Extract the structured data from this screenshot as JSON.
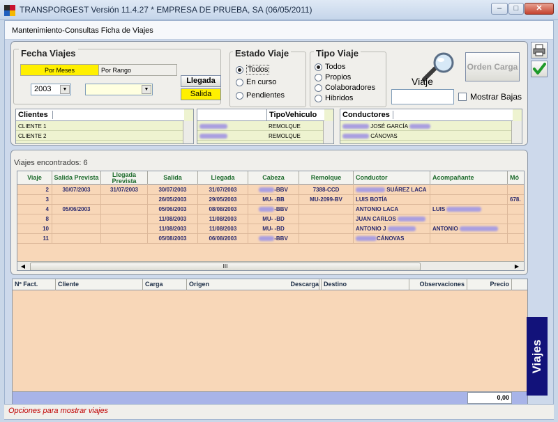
{
  "window": {
    "title": "TRANSPORGEST Versión 11.4.27 * EMPRESA DE PRUEBA, SA (06/05/2011)",
    "subtitle": "Mantenimiento-Consultas Ficha de Viajes"
  },
  "fecha": {
    "title": "Fecha Viajes",
    "tabs": [
      "Por Meses",
      "Por Rango"
    ],
    "year": "2003",
    "month": "",
    "llegada_label": "Llegada",
    "salida_label": "Salida"
  },
  "estado": {
    "title": "Estado Viaje",
    "options": [
      "Todos",
      "En curso",
      "Pendientes"
    ],
    "selected": "Todos"
  },
  "tipo": {
    "title": "Tipo Viaje",
    "options": [
      "Todos",
      "Propios",
      "Colaboradores",
      "Hibridos"
    ],
    "selected": "Todos"
  },
  "viaje": {
    "label": "Viaje",
    "value": ""
  },
  "orden_carga_label": "Orden Carga",
  "mostrar_bajas_label": "Mostrar Bajas",
  "clientes": {
    "header": "Clientes",
    "rows": [
      "CLIENTE 1",
      "CLIENTE 2"
    ]
  },
  "vehiculos": {
    "header": "TipoVehiculo",
    "rows": [
      "REMOLQUE",
      "REMOLQUE"
    ]
  },
  "conductores": {
    "header": "Conductores",
    "rows": [
      "JOSÉ GARCÍA",
      "CÁNOVAS"
    ]
  },
  "viajes": {
    "count_label": "Viajes encontrados: 6",
    "headers": [
      "Viaje",
      "Salida Prevista",
      "Llegada Prevista",
      "Salida",
      "Llegada",
      "Cabeza",
      "Remolque",
      "Conductor",
      "Acompañante",
      "Mó"
    ],
    "rows": [
      [
        "2",
        "30/07/2003",
        "31/07/2003",
        "30/07/2003",
        "31/07/2003",
        "-BBV",
        "7388-CCD",
        "SUÁREZ LACA",
        "",
        ""
      ],
      [
        "3",
        "",
        "",
        "26/05/2003",
        "29/05/2003",
        "MU-   -BB",
        "MU-2099-BV",
        "LUIS   BOTÍA",
        "",
        "678."
      ],
      [
        "4",
        "05/06/2003",
        "",
        "05/06/2003",
        "08/08/2003",
        "-BBV",
        "",
        "ANTONIO   LACA",
        "LUIS",
        ""
      ],
      [
        "8",
        "",
        "",
        "11/08/2003",
        "11/08/2003",
        "MU-   -BD",
        "",
        "JUAN CARLOS",
        "",
        ""
      ],
      [
        "10",
        "",
        "",
        "11/08/2003",
        "11/08/2003",
        "MU-   -BD",
        "",
        "ANTONIO J",
        "ANTONIO",
        ""
      ],
      [
        "11",
        "",
        "",
        "05/08/2003",
        "06/08/2003",
        "-BBV",
        "",
        "CÁNOVAS",
        "",
        ""
      ]
    ]
  },
  "bottom": {
    "headers": [
      "Nº Fact.",
      "Cliente",
      "Carga",
      "Origen",
      "Descarga",
      "Destino",
      "Observaciones",
      "Precio"
    ],
    "total": "0,00"
  },
  "side_tab_label": "Viajes",
  "status_text": "Opciones para mostrar viajes",
  "scroll_marker": "III"
}
